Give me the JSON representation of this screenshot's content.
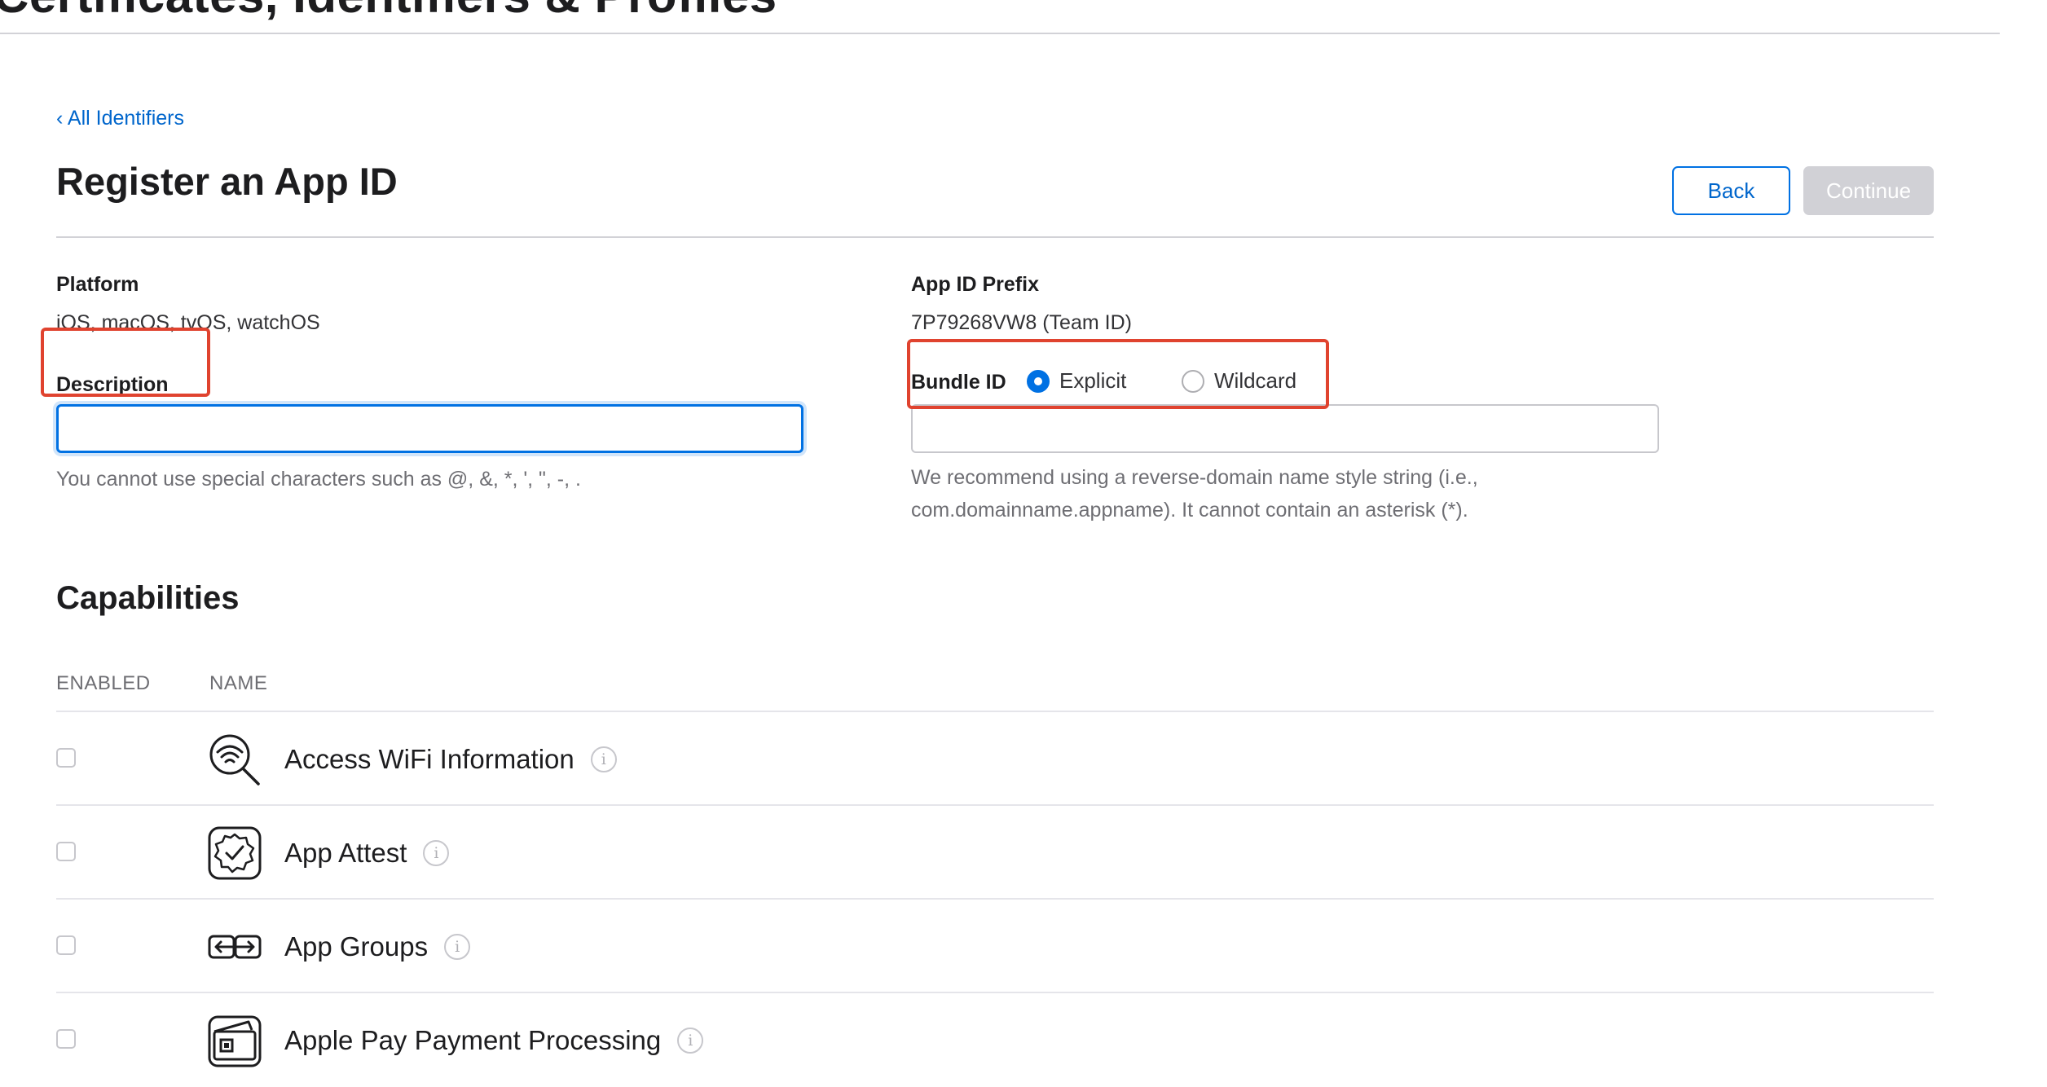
{
  "header": {
    "site_title": "Certificates, Identifiers & Profiles"
  },
  "nav": {
    "back_link": "‹ All Identifiers"
  },
  "page": {
    "title": "Register an App ID"
  },
  "buttons": {
    "back": "Back",
    "continue": "Continue"
  },
  "platform": {
    "label": "Platform",
    "value": "iOS, macOS, tvOS, watchOS"
  },
  "prefix": {
    "label": "App ID Prefix",
    "value": "7P79268VW8 (Team ID)"
  },
  "description": {
    "label": "Description",
    "value": "",
    "placeholder": "",
    "help": "You cannot use special characters such as @, &, *, ', \", -, ."
  },
  "bundle": {
    "label": "Bundle ID",
    "options": [
      {
        "label": "Explicit",
        "selected": true
      },
      {
        "label": "Wildcard",
        "selected": false
      }
    ],
    "value": "",
    "help_line1": "We recommend using a reverse-domain name style string (i.e.,",
    "help_line2": "com.domainname.appname). It cannot contain an asterisk (*)."
  },
  "capabilities": {
    "title": "Capabilities",
    "columns": {
      "enabled": "ENABLED",
      "name": "NAME"
    },
    "rows": [
      {
        "name": "Access WiFi Information",
        "icon": "wifi-search-icon",
        "enabled": false
      },
      {
        "name": "App Attest",
        "icon": "badge-check-icon",
        "enabled": false
      },
      {
        "name": "App Groups",
        "icon": "app-groups-icon",
        "enabled": false
      },
      {
        "name": "Apple Pay Payment Processing",
        "icon": "wallet-cards-icon",
        "enabled": false
      }
    ]
  },
  "colors": {
    "link": "#0066cc",
    "accent": "#0071e3",
    "annotation": "#e0432f",
    "disabled_button": "#d1d1d6"
  }
}
